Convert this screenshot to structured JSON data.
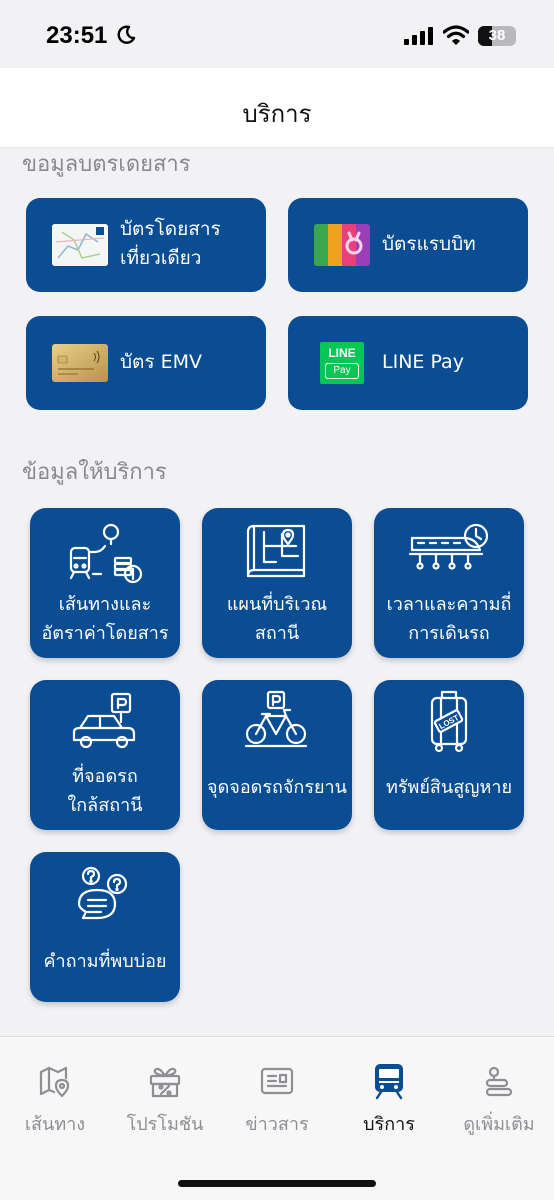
{
  "status_bar": {
    "time": "23:51",
    "battery": "38",
    "battery_level": 0.38
  },
  "header": {
    "title": "บริการ"
  },
  "section_cards": {
    "title": "ขอมูลบตรเดยสาร"
  },
  "cards": [
    {
      "label_line1": "บัตรโดยสาร",
      "label_line2": "เที่ยวเดียว",
      "icon": "single-journey-card-icon"
    },
    {
      "label": "บัตรแรบบิท",
      "icon": "rabbit-card-icon"
    },
    {
      "label": "บัตร EMV",
      "icon": "emv-card-icon"
    },
    {
      "label": "LINE Pay",
      "icon": "line-pay-icon",
      "logo_line1": "LINE",
      "logo_line2": "Pay"
    }
  ],
  "section_services": {
    "title": "ข้อมูลให้บริการ"
  },
  "services": [
    {
      "line1": "เส้นทางและ",
      "line2": "อัตราค่าโดยสาร",
      "icon": "route-fare-icon"
    },
    {
      "line1": "แผนที่บริเวณ",
      "line2": "สถานี",
      "icon": "station-map-icon"
    },
    {
      "line1": "เวลาและความถี่",
      "line2": "การเดินรถ",
      "icon": "train-schedule-icon"
    },
    {
      "line1": "ที่จอดรถ",
      "line2": "ใกล้สถานี",
      "icon": "car-parking-icon"
    },
    {
      "line1": "จุดจอดรถจักรยาน",
      "icon": "bicycle-parking-icon"
    },
    {
      "line1": "ทรัพย์สินสูญหาย",
      "icon": "lost-luggage-icon",
      "badge": "LOST"
    },
    {
      "line1": "คำถามที่พบบ่อย",
      "icon": "faq-chat-icon"
    }
  ],
  "tabs": [
    {
      "label": "เส้นทาง",
      "icon": "map-pin-icon",
      "active": false
    },
    {
      "label": "โปรโมชัน",
      "icon": "gift-percent-icon",
      "active": false
    },
    {
      "label": "ข่าวสาร",
      "icon": "news-icon",
      "active": false
    },
    {
      "label": "บริการ",
      "icon": "train-icon",
      "active": true
    },
    {
      "label": "ดูเพิ่มเติม",
      "icon": "more-icon",
      "active": false
    }
  ],
  "colors": {
    "primary": "#0a4d93",
    "background": "#f2f2f4",
    "line_green": "#06c755"
  }
}
